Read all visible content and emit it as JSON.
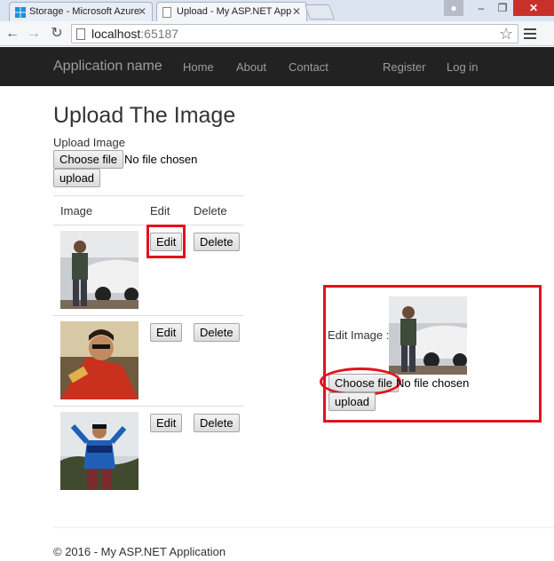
{
  "browser": {
    "tabs": [
      {
        "title": "Storage - Microsoft Azure",
        "active": false
      },
      {
        "title": "Upload - My ASP.NET App",
        "active": true
      }
    ],
    "address": {
      "host": "localhost",
      "port": ":65187"
    },
    "window_controls": {
      "minimize": "–",
      "maximize": "❐",
      "close": "✕"
    }
  },
  "navbar": {
    "brand": "Application name",
    "links": [
      "Home",
      "About",
      "Contact"
    ],
    "right_links": [
      "Register",
      "Log in"
    ]
  },
  "page": {
    "title": "Upload The Image",
    "upload_label": "Upload Image",
    "choose_file": "Choose file",
    "no_file": "No file chosen",
    "upload_button": "upload"
  },
  "table": {
    "headers": [
      "Image",
      "Edit",
      "Delete"
    ],
    "rows": [
      {
        "edit": "Edit",
        "delete": "Delete",
        "image": "photo-man-with-car"
      },
      {
        "edit": "Edit",
        "delete": "Delete",
        "image": "photo-man-selfie"
      },
      {
        "edit": "Edit",
        "delete": "Delete",
        "image": "photo-man-blue-jacket"
      }
    ]
  },
  "edit_panel": {
    "label": "Edit Image :",
    "choose_file": "Choose file",
    "no_file": "No file chosen",
    "upload_button": "upload",
    "image": "photo-man-with-car"
  },
  "footer": {
    "text": "© 2016 - My ASP.NET Application"
  },
  "colors": {
    "navbar": "#222222",
    "highlight": "#e3121c",
    "nav_text": "#9d9d9d"
  }
}
